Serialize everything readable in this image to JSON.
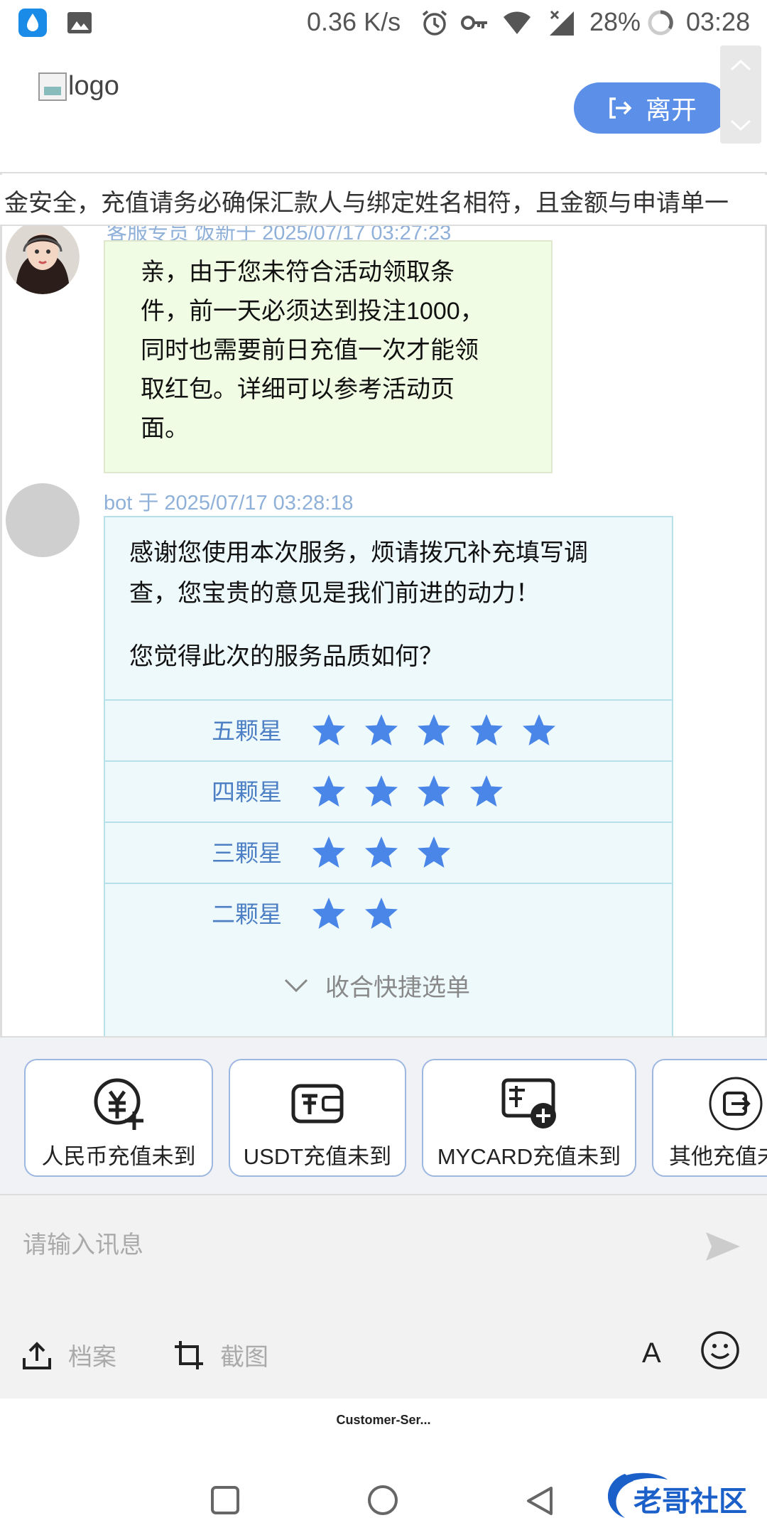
{
  "status_bar": {
    "speed": "0.36 K/s",
    "battery": "28%",
    "time": "03:28"
  },
  "header": {
    "logo_alt": "logo",
    "leave_label": "离开"
  },
  "marquee": {
    "text": "金安全，充值请务必确保汇款人与绑定姓名相符，且金额与申请单一"
  },
  "messages": [
    {
      "meta": "客服专员 饭新于 2025/07/17 03:27:23",
      "lines": [
        "亲，由于您未符合活动领取条",
        "件，前一天必须达到投注1000，",
        "同时也需要前日充值一次才能领",
        "取红包。详细可以参考活动页",
        "面。"
      ]
    },
    {
      "meta": "bot 于 2025/07/17 03:28:18",
      "lines": [
        "感谢您使用本次服务，烦请拨冗补充填写调",
        "查，您宝贵的意见是我们前进的动力！",
        "",
        "您觉得此次的服务品质如何？"
      ],
      "ratings": [
        {
          "label": "五颗星",
          "stars": 5
        },
        {
          "label": "四颗星",
          "stars": 4
        },
        {
          "label": "三颗星",
          "stars": 3
        },
        {
          "label": "二颗星",
          "stars": 2
        }
      ]
    }
  ],
  "collapse_label": "收合快捷选单",
  "quick_options": [
    {
      "label": "人民币充值未到",
      "icon": "yuan-add-icon"
    },
    {
      "label": "USDT充值未到",
      "icon": "wallet-icon"
    },
    {
      "label": "MYCARD充值未到",
      "icon": "card-add-icon"
    },
    {
      "label": "其他充值未",
      "icon": "exit-box-icon"
    }
  ],
  "input": {
    "placeholder": "请输入讯息"
  },
  "tools": {
    "file_label": "档案",
    "screenshot_label": "截图",
    "font_label": "A"
  },
  "app_label": "Customer-Ser...",
  "watermark": "老哥社区",
  "colors": {
    "accent": "#5b8fe8",
    "star": "#4a86e8",
    "agent_bubble": "#f0fce3",
    "bot_bubble": "#eef9fc"
  }
}
